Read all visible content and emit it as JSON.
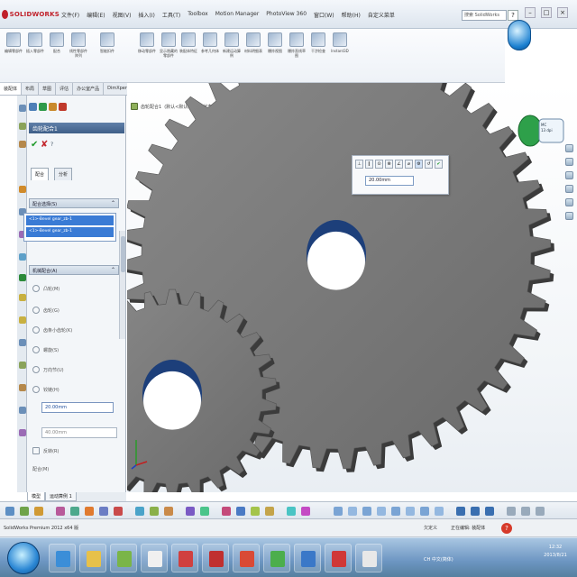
{
  "app": {
    "logo_text": "SOLIDWORKS",
    "menus": [
      "文件(F)",
      "编辑(E)",
      "视图(V)",
      "插入(I)",
      "工具(T)",
      "Toolbox",
      "Motion Manager",
      "PhotoView 360",
      "窗口(W)",
      "帮助(H)",
      "自定义菜单"
    ],
    "search_placeholder": "搜索 SolidWorks",
    "help_label": "?"
  },
  "ribbon": {
    "buttons": [
      "编辑零部件",
      "插入零部件",
      "配合",
      "线性零部件阵列",
      "智能扣件",
      "移动零部件",
      "显示隐藏的零部件",
      "装配体特征",
      "参考几何体",
      "新建运动算例",
      "材料明细表",
      "爆炸视图",
      "爆炸直线草图",
      "干涉检查",
      "Instant3D"
    ]
  },
  "tabs": [
    "装配体",
    "布局",
    "草图",
    "评估",
    "办公室产品",
    "DimXpert"
  ],
  "active_tab_index": 0,
  "breadcrumb": {
    "label": "齿轮配合1",
    "parts": "(默认<默认>_显示状态 1)"
  },
  "property_manager": {
    "title": "齿轮配合1",
    "ok_icon": "✔",
    "cancel_icon": "✘",
    "help_icon": "?",
    "subtabs": [
      "配合",
      "分析"
    ],
    "selection_group": "配合选择(S)",
    "selections": [
      "<1>-Bevel gear_zb-1",
      "<1>-Bevel gear_zb-1"
    ],
    "mechanical_group": "机械配合(A)",
    "mate_types": [
      "凸轮(M)",
      "齿轮(G)",
      "齿条小齿轮(K)",
      "螺旋(S)",
      "万向节(U)",
      "铰链(H)"
    ],
    "ratio_value": "20.00mm",
    "ratio_value2": "40.00mm",
    "reverse_label": "反转(R)",
    "selections_label": "配合(M)"
  },
  "mate_popup": {
    "buttons": [
      "⊥",
      "∥",
      "⊙",
      "⊗",
      "∠",
      "⌀",
      "⚙",
      "↺"
    ],
    "ok_icon": "✔",
    "field_value": "20.00mm"
  },
  "right_badge": "MC\n13 dpi",
  "model_tabs": [
    "模型",
    "运动算例 1"
  ],
  "status": {
    "left": "SolidWorks Premium 2012 x64 版",
    "mid": "欠定义",
    "right": "正在编辑: 装配体",
    "help_icon": "?"
  },
  "taskbar": {
    "tray_text": "CH 中文(简体)",
    "clock_time": "12:32",
    "clock_date": "2013/8/21"
  }
}
